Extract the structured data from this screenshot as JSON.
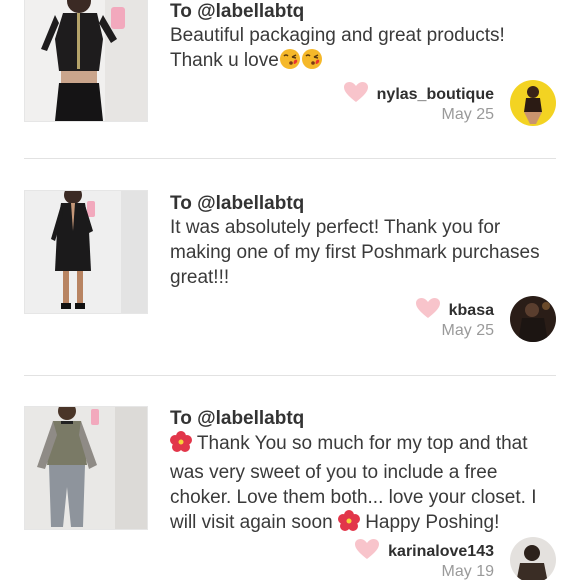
{
  "colors": {
    "heart": "#f8c4cb",
    "text": "#3a3a3a",
    "muted": "#9a9a9a",
    "divider": "#e2e2e2"
  },
  "notes": [
    {
      "to": "To @labellabtq",
      "message_parts": [
        "Beautiful packaging and great products! Thank u love"
      ],
      "emoji": [
        "kissing-face-emoji",
        "kissing-face-emoji"
      ],
      "username": "nylas_boutique",
      "date": "May 25"
    },
    {
      "to": "To @labellabtq",
      "message_parts": [
        "It was absolutely perfect! Thank you for making one of my first Poshmark purchases great!!!"
      ],
      "username": "kbasa",
      "date": "May 25"
    },
    {
      "to": "To @labellabtq",
      "message_parts": [
        " Thank You so much for my top and that was very sweet of you to include a free choker. Love them both... love your closet. I will visit again soon ",
        " Happy Poshing!"
      ],
      "emoji": [
        "hibiscus-emoji",
        "hibiscus-emoji"
      ],
      "username": "karinalove143",
      "date": "May 19"
    }
  ]
}
